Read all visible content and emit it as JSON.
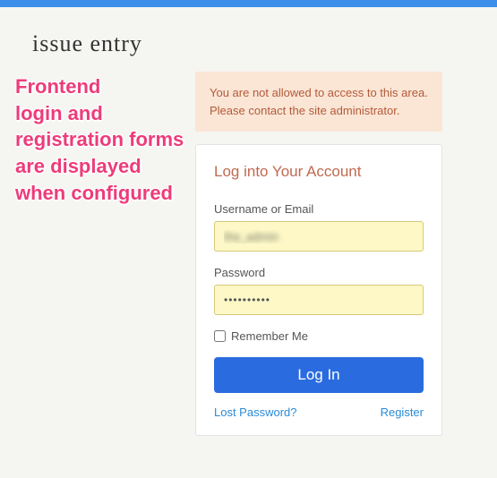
{
  "topbar": {
    "color": "#3b8eea"
  },
  "site": {
    "title": "issue entry"
  },
  "annotation": {
    "text": "Frontend\nlogin and\nregistration forms\nare displayed\nwhen configured"
  },
  "alert": {
    "text": "You are not allowed to access to this area. Please contact the site administrator."
  },
  "login": {
    "title": "Log into Your Account",
    "username_label": "Username or Email",
    "username_value": "the_admin",
    "password_label": "Password",
    "password_value": "••••••••••",
    "remember_label": "Remember Me",
    "submit_label": "Log In",
    "lost_password_label": "Lost Password?",
    "register_label": "Register"
  }
}
